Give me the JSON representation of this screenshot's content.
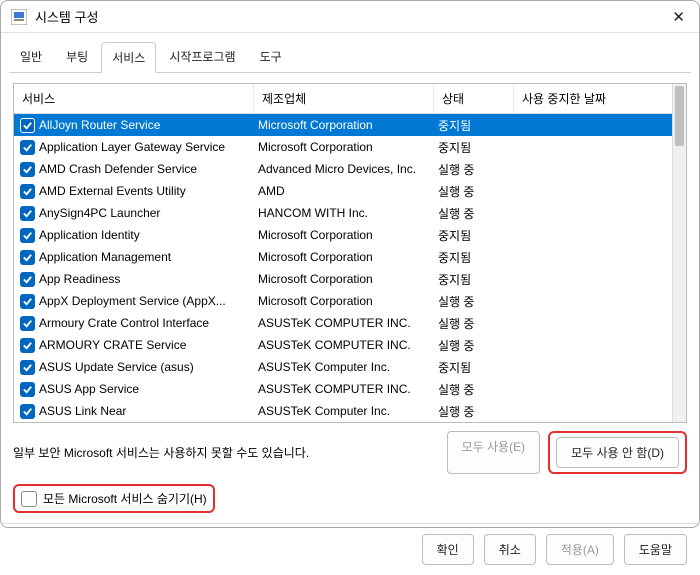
{
  "window": {
    "title": "시스템 구성"
  },
  "tabs": [
    {
      "label": "일반",
      "active": false
    },
    {
      "label": "부팅",
      "active": false
    },
    {
      "label": "서비스",
      "active": true
    },
    {
      "label": "시작프로그램",
      "active": false
    },
    {
      "label": "도구",
      "active": false
    }
  ],
  "columns": {
    "service": "서비스",
    "manufacturer": "제조업체",
    "status": "상태",
    "date": "사용 중지한 날짜"
  },
  "rows": [
    {
      "checked": true,
      "selected": true,
      "service": "AllJoyn Router Service",
      "manufacturer": "Microsoft Corporation",
      "status": "중지됨"
    },
    {
      "checked": true,
      "selected": false,
      "service": "Application Layer Gateway Service",
      "manufacturer": "Microsoft Corporation",
      "status": "중지됨"
    },
    {
      "checked": true,
      "selected": false,
      "service": "AMD Crash Defender Service",
      "manufacturer": "Advanced Micro Devices, Inc.",
      "status": "실행 중"
    },
    {
      "checked": true,
      "selected": false,
      "service": "AMD External Events Utility",
      "manufacturer": "AMD",
      "status": "실행 중"
    },
    {
      "checked": true,
      "selected": false,
      "service": "AnySign4PC Launcher",
      "manufacturer": "HANCOM WITH Inc.",
      "status": "실행 중"
    },
    {
      "checked": true,
      "selected": false,
      "service": "Application Identity",
      "manufacturer": "Microsoft Corporation",
      "status": "중지됨"
    },
    {
      "checked": true,
      "selected": false,
      "service": "Application Management",
      "manufacturer": "Microsoft Corporation",
      "status": "중지됨"
    },
    {
      "checked": true,
      "selected": false,
      "service": "App Readiness",
      "manufacturer": "Microsoft Corporation",
      "status": "중지됨"
    },
    {
      "checked": true,
      "selected": false,
      "service": "AppX Deployment Service (AppX...",
      "manufacturer": "Microsoft Corporation",
      "status": "실행 중"
    },
    {
      "checked": true,
      "selected": false,
      "service": "Armoury Crate Control Interface",
      "manufacturer": "ASUSTeK COMPUTER INC.",
      "status": "실행 중"
    },
    {
      "checked": true,
      "selected": false,
      "service": "ARMOURY CRATE Service",
      "manufacturer": "ASUSTeK COMPUTER INC.",
      "status": "실행 중"
    },
    {
      "checked": true,
      "selected": false,
      "service": "ASUS Update Service (asus)",
      "manufacturer": "ASUSTeK Computer Inc.",
      "status": "중지됨"
    },
    {
      "checked": true,
      "selected": false,
      "service": "ASUS App Service",
      "manufacturer": "ASUSTeK COMPUTER INC.",
      "status": "실행 중"
    },
    {
      "checked": true,
      "selected": false,
      "service": "ASUS Link Near",
      "manufacturer": "ASUSTeK Computer Inc.",
      "status": "실행 중"
    }
  ],
  "notice": "일부 보안 Microsoft 서비스는 사용하지 못할 수도 있습니다.",
  "buttons": {
    "enable_all": "모두 사용(E)",
    "disable_all": "모두 사용 안 함(D)",
    "hide_ms": "모든 Microsoft 서비스 숨기기(H)",
    "ok": "확인",
    "cancel": "취소",
    "apply": "적용(A)",
    "help": "도움말"
  }
}
